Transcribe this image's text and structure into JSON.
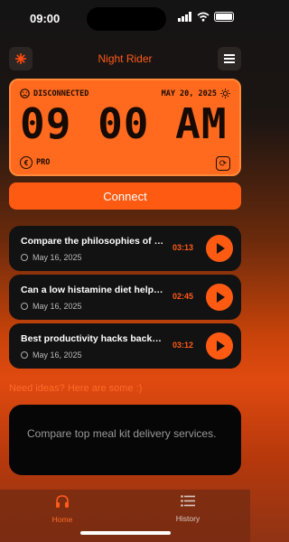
{
  "status_bar": {
    "time": "09:00"
  },
  "header": {
    "title": "Night Rider",
    "left_icon": "sun-burst-icon",
    "right_icon": "menu-icon"
  },
  "clock_card": {
    "status": "DISCONNECTED",
    "date": "MAY 20, 2025",
    "time": "09 00 AM",
    "plan": "PRO"
  },
  "connect_label": "Connect",
  "history": [
    {
      "title": "Compare the philosophies of Kant and Nietzsche",
      "date": "May 16, 2025",
      "duration": "03:13"
    },
    {
      "title": "Can a low histamine diet help with migraines?",
      "date": "May 16, 2025",
      "duration": "02:45"
    },
    {
      "title": "Best productivity hacks backed by science",
      "date": "May 16, 2025",
      "duration": "03:12"
    }
  ],
  "ideas": {
    "label": "Need ideas? Here are some :)",
    "card_text": "Compare top meal kit delivery services."
  },
  "tabs": [
    {
      "label": "Home",
      "icon": "headphones-icon",
      "active": true
    },
    {
      "label": "History",
      "icon": "list-icon",
      "active": false
    }
  ],
  "colors": {
    "accent": "#ff5a12",
    "clock_bg": "#ff6a1e",
    "card": "#121212"
  }
}
